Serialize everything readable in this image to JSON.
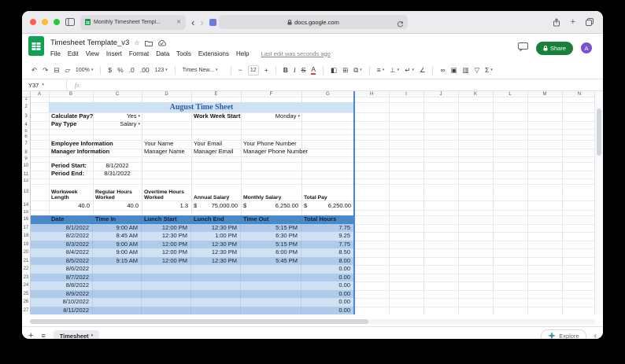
{
  "colors": {
    "light-close": "#ff5f57",
    "light-min": "#febc2e",
    "light-max": "#28c840",
    "accent-green": "#188038",
    "logo-green": "#12a150",
    "avatar-purple": "#7b52c7",
    "title-bg": "#cfe2f3",
    "title-text": "#2a5ca8",
    "table-header-bg": "#4a89c8",
    "band-dark": "#b0cbe9",
    "band-light": "#d0e1f4",
    "range-line": "#4285f4"
  },
  "browser": {
    "tab_title": "Monthly Timesheet Templ...",
    "close_tab": "✕",
    "back": "‹",
    "forward": "›",
    "url": "docs.google.com",
    "new_tab": "+"
  },
  "app": {
    "title": "Timesheet Template_v3",
    "star": "☆",
    "menu": [
      "File",
      "Edit",
      "View",
      "Insert",
      "Format",
      "Data",
      "Tools",
      "Extensions",
      "Help"
    ],
    "last_edit": "Last edit was seconds ago",
    "share_label": "Share",
    "avatar": "A"
  },
  "toolbar": {
    "items": [
      {
        "name": "undo",
        "glyph": "↶"
      },
      {
        "name": "redo",
        "glyph": "↷"
      },
      {
        "name": "print",
        "glyph": "⊟"
      },
      {
        "name": "paint-format",
        "glyph": "▱"
      },
      {
        "name": "zoom-select",
        "glyph": "100%",
        "caret": true
      },
      {
        "name": "sep"
      },
      {
        "name": "format-currency",
        "glyph": "$"
      },
      {
        "name": "format-percent",
        "glyph": "%"
      },
      {
        "name": "decrease-decimals",
        "glyph": ".0"
      },
      {
        "name": "increase-decimals",
        "glyph": ".00"
      },
      {
        "name": "number-format",
        "glyph": "123",
        "caret": true
      },
      {
        "name": "sep"
      },
      {
        "name": "font-family",
        "glyph": "Times New...",
        "caret": true
      },
      {
        "name": "sep"
      },
      {
        "name": "decrease-font-size",
        "glyph": "−"
      },
      {
        "name": "font-size",
        "glyph": "12"
      },
      {
        "name": "increase-font-size",
        "glyph": "+"
      },
      {
        "name": "sep"
      },
      {
        "name": "bold",
        "glyph": "B"
      },
      {
        "name": "italic",
        "glyph": "I"
      },
      {
        "name": "strikethrough",
        "glyph": "S"
      },
      {
        "name": "text-color",
        "glyph": "A"
      },
      {
        "name": "sep"
      },
      {
        "name": "fill-color",
        "glyph": "◧"
      },
      {
        "name": "borders",
        "glyph": "⊞"
      },
      {
        "name": "merge-cells",
        "glyph": "⧉",
        "caret": true
      },
      {
        "name": "sep"
      },
      {
        "name": "horizontal-align",
        "glyph": "≡",
        "caret": true
      },
      {
        "name": "vertical-align",
        "glyph": "⊥",
        "caret": true
      },
      {
        "name": "text-wrap",
        "glyph": "↵",
        "caret": true
      },
      {
        "name": "text-rotation",
        "glyph": "∠"
      },
      {
        "name": "sep"
      },
      {
        "name": "insert-link",
        "glyph": "∞"
      },
      {
        "name": "insert-comment",
        "glyph": "▣"
      },
      {
        "name": "insert-chart",
        "glyph": "▥"
      },
      {
        "name": "create-filter",
        "glyph": "▽"
      },
      {
        "name": "functions",
        "glyph": "Σ",
        "caret": true
      }
    ]
  },
  "formula": {
    "cell_ref": "Y37",
    "fx": "fx"
  },
  "grid": {
    "columns": [
      "A",
      "B",
      "C",
      "D",
      "E",
      "F",
      "G",
      "H",
      "I",
      "J",
      "K",
      "L",
      "M",
      "N"
    ],
    "rows": [
      1,
      2,
      3,
      4,
      5,
      6,
      7,
      8,
      9,
      10,
      11,
      12,
      13,
      14,
      15,
      16,
      17,
      18,
      19,
      20,
      21,
      22,
      23,
      24,
      25,
      26,
      27
    ]
  },
  "sheet": {
    "title": "August Time Sheet",
    "settings": {
      "calculate_pay": {
        "label": "Calculate Pay?",
        "value": "Yes"
      },
      "pay_type": {
        "label": "Pay Type",
        "value": "Salary"
      },
      "work_week_start": {
        "label": "Work Week Start",
        "value": "Monday"
      }
    },
    "employee": {
      "label": "Employee Information",
      "name": "Your Name",
      "email": "Your Email",
      "phone": "Your Phone Number"
    },
    "manager": {
      "label": "Manager Information",
      "name": "Manager Name",
      "email": "Manager Email",
      "phone": "Manager Phone Number"
    },
    "period": {
      "start_label": "Period Start:",
      "start_value": "8/1/2022",
      "end_label": "Period End:",
      "end_value": "8/31/2022"
    },
    "summary": [
      {
        "label": "Workweek Length",
        "value": "40.0",
        "currency": false
      },
      {
        "label": "Regular Hours Worked",
        "value": "40.0",
        "currency": false
      },
      {
        "label": "Overtime Hours Worked",
        "value": "1.3",
        "currency": false
      },
      {
        "label": "Annual Salary",
        "value": "75,000.00",
        "currency": true
      },
      {
        "label": "Monthly Salary",
        "value": "6,250.00",
        "currency": true
      },
      {
        "label": "Total Pay",
        "value": "6,250.00",
        "currency": true
      }
    ],
    "table": {
      "headers": [
        "Date",
        "Time In",
        "Lunch Start",
        "Lunch End",
        "Time Out",
        "Total Hours"
      ],
      "rows": [
        [
          "8/1/2022",
          "9:00 AM",
          "12:00 PM",
          "12:30 PM",
          "5:15 PM",
          "7.75"
        ],
        [
          "8/2/2022",
          "8:45 AM",
          "12:30 PM",
          "1:00 PM",
          "6:30 PM",
          "9.25"
        ],
        [
          "8/3/2022",
          "9:00 AM",
          "12:00 PM",
          "12:30 PM",
          "5:15 PM",
          "7.75"
        ],
        [
          "8/4/2022",
          "9:00 AM",
          "12:00 PM",
          "12:30 PM",
          "6:00 PM",
          "8.50"
        ],
        [
          "8/5/2022",
          "9:15 AM",
          "12:00 PM",
          "12:30 PM",
          "5:45 PM",
          "8.00"
        ],
        [
          "8/6/2022",
          "",
          "",
          "",
          "",
          "0.00"
        ],
        [
          "8/7/2022",
          "",
          "",
          "",
          "",
          "0.00"
        ],
        [
          "8/8/2022",
          "",
          "",
          "",
          "",
          "0.00"
        ],
        [
          "8/9/2022",
          "",
          "",
          "",
          "",
          "0.00"
        ],
        [
          "8/10/2022",
          "",
          "",
          "",
          "",
          "0.00"
        ],
        [
          "8/11/2022",
          "",
          "",
          "",
          "",
          "0.00"
        ]
      ]
    }
  },
  "bottom": {
    "add_sheet": "+",
    "all_sheets": "≡",
    "tab": "Timesheet",
    "explore": "Explore",
    "collapse": "‹"
  }
}
